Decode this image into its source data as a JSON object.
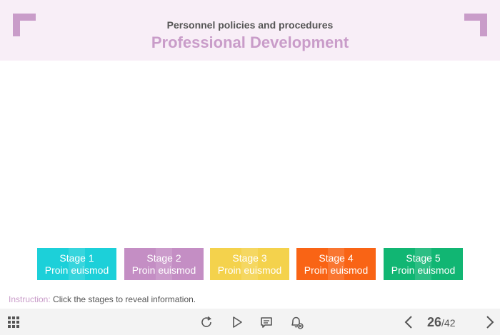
{
  "header": {
    "subtitle": "Personnel policies and procedures",
    "title": "Professional Development"
  },
  "stages": [
    {
      "label": "Stage 1",
      "sub": "Proin euismod",
      "color": "#1cd0d9"
    },
    {
      "label": "Stage 2",
      "sub": "Proin euismod",
      "color": "#c48ec4"
    },
    {
      "label": "Stage 3",
      "sub": "Proin euismod",
      "color": "#f4d24c"
    },
    {
      "label": "Stage 4",
      "sub": "Proin euismod",
      "color": "#f96415"
    },
    {
      "label": "Stage 5",
      "sub": "Proin euismod",
      "color": "#11b673"
    }
  ],
  "instruction": {
    "label": "Instruction:",
    "text": "Click the stages to reveal information."
  },
  "toolbar": {
    "icons": [
      "grid-menu-icon",
      "replay-icon",
      "play-icon",
      "comment-icon",
      "notification-muted-icon",
      "prev-arrow-icon",
      "next-arrow-icon"
    ],
    "current_page": "26",
    "total_pages": "/42"
  }
}
